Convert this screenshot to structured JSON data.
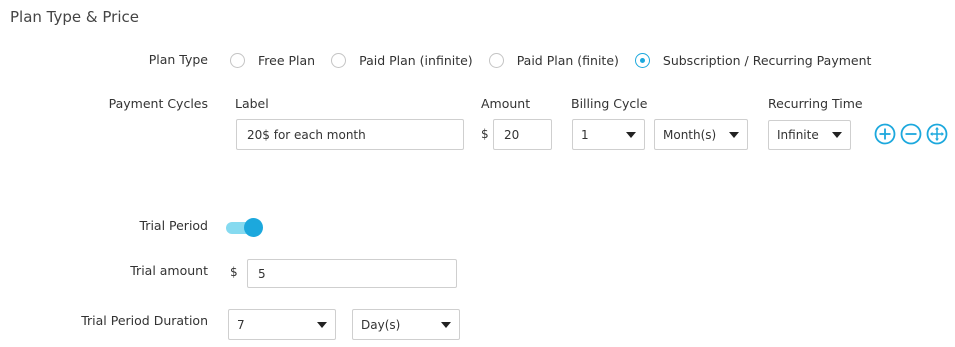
{
  "section": {
    "title": "Plan Type & Price"
  },
  "plan_type": {
    "label": "Plan Type",
    "options": [
      {
        "label": "Free Plan",
        "checked": false
      },
      {
        "label": "Paid Plan (infinite)",
        "checked": false
      },
      {
        "label": "Paid Plan (finite)",
        "checked": false
      },
      {
        "label": "Subscription / Recurring Payment",
        "checked": true
      }
    ]
  },
  "payment_cycles": {
    "label": "Payment Cycles",
    "headers": {
      "label": "Label",
      "amount": "Amount",
      "billing_cycle": "Billing Cycle",
      "recurring_time": "Recurring Time"
    },
    "row": {
      "label_value": "20$ for each month",
      "currency": "$",
      "amount_value": "20",
      "billing_cycle_count": "1",
      "billing_cycle_unit": "Month(s)",
      "recurring_time": "Infinite"
    },
    "actions": [
      "plus-circle-icon",
      "minus-circle-icon",
      "move-circle-icon"
    ]
  },
  "trial": {
    "period_label": "Trial Period",
    "enabled": true,
    "amount_label": "Trial amount",
    "currency": "$",
    "amount_value": "5",
    "duration_label": "Trial Period Duration",
    "duration_count": "7",
    "duration_unit": "Day(s)"
  },
  "colors": {
    "accent": "#1ca8dd",
    "toggle_track": "#85daf0",
    "border": "#cfcfcf"
  }
}
